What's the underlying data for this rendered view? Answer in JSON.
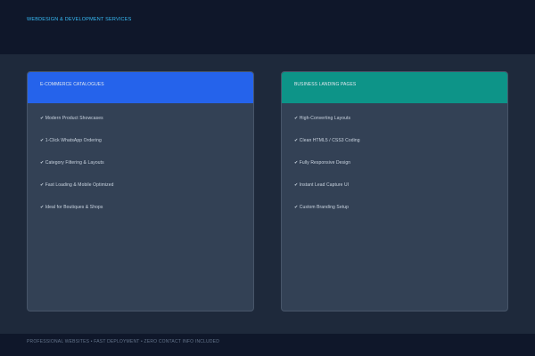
{
  "header": {
    "title": "WEBDESIGN & DEVELOPMENT SERVICES"
  },
  "cards": [
    {
      "title": "E-COMMERCE CATALOGUES",
      "accent": "#2563eb",
      "items": [
        "✔ Modern Product Showcases",
        "✔ 1-Click WhatsApp Ordering",
        "✔ Category Filtering & Layouts",
        "✔ Fast Loading & Mobile Optimized",
        "✔ Ideal for Boutiques & Shops"
      ]
    },
    {
      "title": "BUSINESS LANDING PAGES",
      "accent": "#0d9488",
      "items": [
        "✔ High-Converting Layouts",
        "✔ Clean HTML5 / CSS3 Coding",
        "✔ Fully Responsive Design",
        "✔ Instant Lead Capture UI",
        "✔ Custom Branding Setup"
      ]
    }
  ],
  "footer": {
    "text": "PROFESSIONAL WEBSITES • FAST DEPLOYMENT • ZERO CONTACT INFO INCLUDED"
  }
}
